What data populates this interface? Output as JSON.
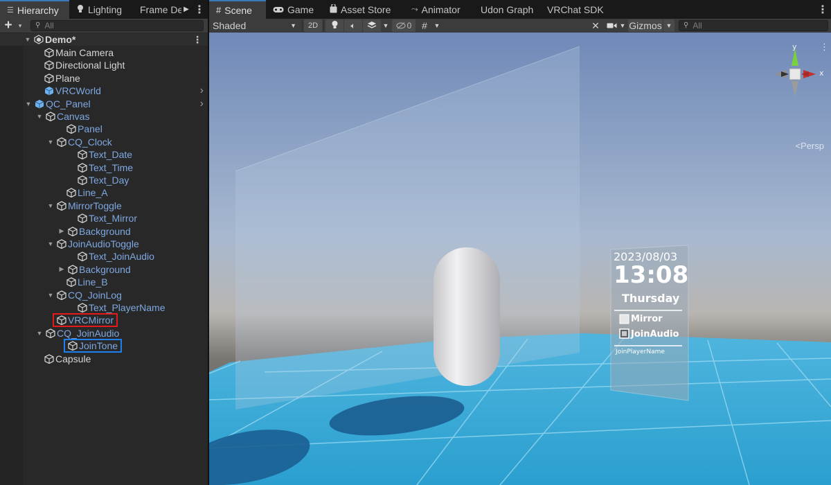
{
  "hierarchy": {
    "tabs": [
      {
        "label": "Hierarchy",
        "icon": "list-icon"
      },
      {
        "label": "Lighting",
        "icon": "bulb-icon"
      },
      {
        "label": "Frame De",
        "icon": ""
      }
    ],
    "search_placeholder": "All",
    "scene_name": "Demo*",
    "items": [
      {
        "label": "Main Camera",
        "color": "white"
      },
      {
        "label": "Directional Light",
        "color": "white"
      },
      {
        "label": "Plane",
        "color": "white"
      },
      {
        "label": "VRCWorld",
        "color": "blue"
      },
      {
        "label": "QC_Panel",
        "color": "blue"
      },
      {
        "label": "Canvas",
        "color": "blue"
      },
      {
        "label": "Panel",
        "color": "blue"
      },
      {
        "label": "CQ_Clock",
        "color": "blue"
      },
      {
        "label": "Text_Date",
        "color": "blue"
      },
      {
        "label": "Text_Time",
        "color": "blue"
      },
      {
        "label": "Text_Day",
        "color": "blue"
      },
      {
        "label": "Line_A",
        "color": "blue"
      },
      {
        "label": "MirrorToggle",
        "color": "blue"
      },
      {
        "label": "Text_Mirror",
        "color": "blue"
      },
      {
        "label": "Background",
        "color": "blue"
      },
      {
        "label": "JoinAudioToggle",
        "color": "blue"
      },
      {
        "label": "Text_JoinAudio",
        "color": "blue"
      },
      {
        "label": "Background",
        "color": "blue"
      },
      {
        "label": "Line_B",
        "color": "blue"
      },
      {
        "label": "CQ_JoinLog",
        "color": "blue"
      },
      {
        "label": "Text_PlayerName",
        "color": "blue"
      },
      {
        "label": "VRCMirror",
        "color": "blue",
        "highlight": "red"
      },
      {
        "label": "CQ_JoinAudio",
        "color": "blue"
      },
      {
        "label": "JoinTone",
        "color": "blue",
        "highlight": "blue"
      },
      {
        "label": "Capsule",
        "color": "white"
      }
    ]
  },
  "scene": {
    "tabs": [
      {
        "label": "Scene",
        "icon": "grid-icon"
      },
      {
        "label": "Game",
        "icon": "gamepad-icon"
      },
      {
        "label": "Asset Store",
        "icon": "bag-icon"
      },
      {
        "label": "Animator",
        "icon": "animator-icon"
      },
      {
        "label": "Udon Graph",
        "icon": ""
      },
      {
        "label": "VRChat SDK",
        "icon": ""
      }
    ],
    "toolbar": {
      "draw_mode": "Shaded",
      "mode_2d": "2D",
      "hidden_count": "0",
      "gizmos": "Gizmos",
      "search_placeholder": "All"
    },
    "gizmo": {
      "y": "y",
      "x": "x",
      "view": "Persp"
    },
    "board": {
      "date": "2023/08/03",
      "time": "13:08",
      "day": "Thursday",
      "mirror": "Mirror",
      "join_audio": "JoinAudio",
      "player_name": "JoinPlayerName"
    }
  },
  "colors": {
    "accent_tab": "#3a79bb",
    "prefab_blue": "#7ea8e2",
    "highlight_red": "#e51a1a",
    "highlight_blue": "#1e7ff0",
    "floor": "#2fa7d6"
  }
}
